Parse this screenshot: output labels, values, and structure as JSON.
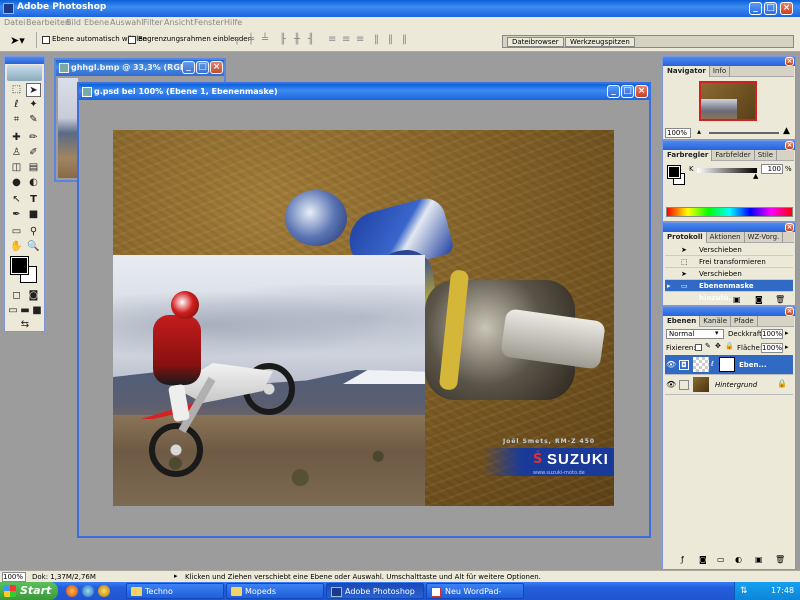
{
  "app": {
    "title": "Adobe Photoshop"
  },
  "menu": [
    "Datei",
    "Bearbeiten",
    "Bild",
    "Ebene",
    "Auswahl",
    "Filter",
    "Ansicht",
    "Fenster",
    "Hilfe"
  ],
  "options": {
    "auto_select": "Ebene automatisch wählen",
    "bounding_box": "Begrenzungsrahmen einblenden",
    "dock_tabs": [
      "Dateibrowser",
      "Werkzeugspitzen"
    ]
  },
  "windows": {
    "back_title": "ghhgl.bmp @ 33,3% (RGB)",
    "front_title": "g.psd bei 100% (Ebene 1, Ebenenmaske)"
  },
  "photo": {
    "caption": "Joël Smets, RM-Z 450",
    "brand": "SUZUKI",
    "url": "www.suzuki-moto.de"
  },
  "navigator": {
    "tabs": [
      "Navigator",
      "Info"
    ],
    "zoom": "100%"
  },
  "color": {
    "tabs": [
      "Farbregler",
      "Farbfelder",
      "Stile"
    ],
    "channel": "K",
    "value": "100",
    "unit": "%"
  },
  "history": {
    "tabs": [
      "Protokoll",
      "Aktionen",
      "WZ-Vorg."
    ],
    "items": [
      "Verschieben",
      "Frei transformieren",
      "Verschieben",
      "Ebenenmaske hinzufü..."
    ]
  },
  "layers": {
    "tabs": [
      "Ebenen",
      "Kanäle",
      "Pfade"
    ],
    "blend_mode": "Normal",
    "opacity_label": "Deckkraft:",
    "opacity": "100%",
    "lock_label": "Fixieren:",
    "fill_label": "Fläche:",
    "fill": "100%",
    "items": [
      "Eben...",
      "Hintergrund"
    ]
  },
  "status": {
    "zoom": "100%",
    "doc": "Dok: 1,37M/2,76M",
    "hint": "Klicken und Ziehen verschiebt eine Ebene oder Auswahl. Umschalttaste und Alt für weitere Optionen."
  },
  "taskbar": {
    "start": "Start",
    "buttons": [
      "Techno",
      "Mopeds",
      "Adobe Photoshop",
      "Neu WordPad-Dokum..."
    ],
    "clock": "17:48"
  },
  "colors": {
    "xp_blue": "#1d63dd",
    "selection": "#316ac5",
    "suzuki_blue": "#1a3a9a"
  }
}
